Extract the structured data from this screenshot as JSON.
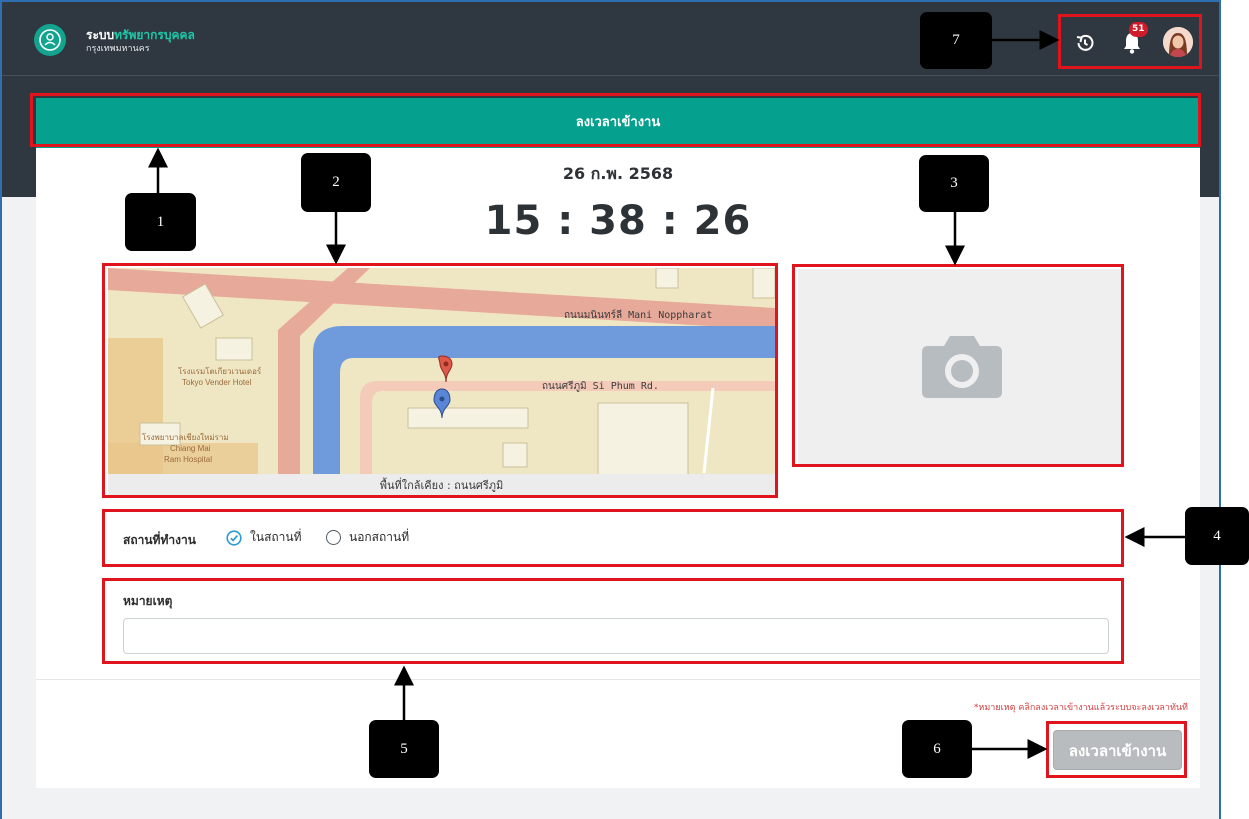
{
  "header": {
    "brand_line1_prefix": "ระบบ",
    "brand_line1_highlight": "ทรัพยากรบุคคล",
    "brand_line2": "กรุงเทพมหานคร",
    "notification_count": "51",
    "icons": [
      "logo-icon",
      "history-icon",
      "bell-icon",
      "avatar"
    ]
  },
  "card": {
    "title": "ลงเวลาเข้างาน",
    "date": "26 ก.พ. 2568",
    "time": "15 : 38 : 26"
  },
  "map": {
    "road_label_1": "ถนนมนินทร์ลี  Mani Noppharat",
    "road_label_2": "ถนนศรีภูมิ  Si Phum Rd.",
    "place_label_1a": "โรงแรมโตเกียวเวนเดอร์",
    "place_label_1b": "Tokyo Vender Hotel",
    "place_label_2a": "โรงพยาบาลเชียงใหม่ราม",
    "place_label_2b": "Chiang Mai",
    "place_label_2c": "Ram Hospital",
    "caption": "พื้นที่ใกล้เคียง  :  ถนนศรีภูมิ"
  },
  "camera": {
    "icon": "camera-icon"
  },
  "worksite": {
    "label": "สถานที่ทำงาน",
    "option_inside": "ในสถานที่",
    "option_outside": "นอกสถานที่",
    "selected": "ในสถานที่"
  },
  "remark": {
    "label": "หมายเหตุ",
    "value": ""
  },
  "footer": {
    "note": "*หมายเหตุ คลิกลงเวลาเข้างานแล้วระบบจะลงเวลาทันที",
    "submit_label": "ลงเวลาเข้างาน"
  },
  "callouts": [
    "1",
    "2",
    "3",
    "4",
    "5",
    "6",
    "7"
  ],
  "colors": {
    "topbar": "#2f3840",
    "accent": "#05a08e",
    "annotation_red": "#e0141d",
    "disabled_button": "#b8bcbf",
    "note_red": "#d34040"
  }
}
